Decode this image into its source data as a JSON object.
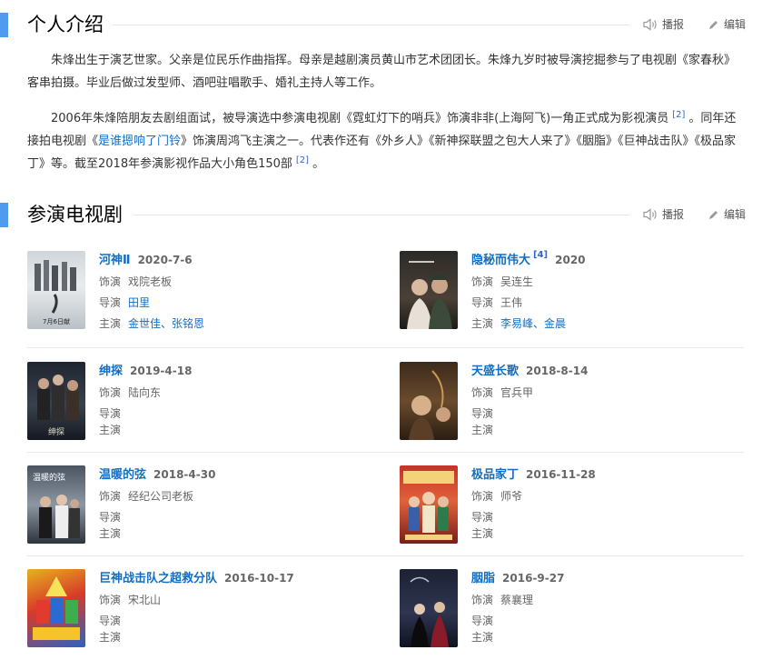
{
  "sections": {
    "intro": {
      "title": "个人介绍",
      "play_label": "播报",
      "edit_label": "编辑"
    },
    "tv": {
      "title": "参演电视剧",
      "play_label": "播报",
      "edit_label": "编辑"
    }
  },
  "intro": {
    "p1": "朱烽出生于演艺世家。父亲是位民乐作曲指挥。母亲是越剧演员黄山市艺术团团长。朱烽九岁时被导演挖掘参与了电视剧《家春秋》客串拍摄。毕业后做过发型师、酒吧驻唱歌手、婚礼主持人等工作。",
    "p2_a": "2006年朱烽陪朋友去剧组面试，被导演选中参演电视剧《霓虹灯下的哨兵》饰演非非(上海阿飞)一角正式成为影视演员",
    "p2_ref1": "[2]",
    "p2_b": "。同年还接拍电视剧《",
    "p2_link": "是谁摁响了门铃",
    "p2_c": "》饰演周鸿飞主演之一。代表作还有《外乡人》《新神探联盟之包大人来了》《胭脂》《巨神战击队》《极品家丁》等。截至2018年参演影视作品大小角色150部",
    "p2_ref2": "[2]",
    "p2_d": "。"
  },
  "labels": {
    "role": "饰演",
    "director": "导演",
    "cast": "主演"
  },
  "tv_items": [
    {
      "title": "河神Ⅱ",
      "sup": "",
      "date": "2020-7-6",
      "role": "戏院老板",
      "director": "田里",
      "cast": "金世佳、张铭恩"
    },
    {
      "title": "隐秘而伟大",
      "sup": "[4]",
      "date": "2020",
      "role": "吴连生",
      "director": "王伟",
      "cast": "李易峰、金晨"
    },
    {
      "title": "绅探",
      "sup": "",
      "date": "2019-4-18",
      "role": "陆向东",
      "director": "",
      "cast": ""
    },
    {
      "title": "天盛长歌",
      "sup": "",
      "date": "2018-8-14",
      "role": "官兵甲",
      "director": "",
      "cast": ""
    },
    {
      "title": "温暖的弦",
      "sup": "",
      "date": "2018-4-30",
      "role": "经纪公司老板",
      "director": "",
      "cast": ""
    },
    {
      "title": "极品家丁",
      "sup": "",
      "date": "2016-11-28",
      "role": "师爷",
      "director": "",
      "cast": ""
    },
    {
      "title": "巨神战击队之超救分队",
      "sup": "",
      "date": "2016-10-17",
      "role": "宋北山",
      "director": "",
      "cast": ""
    },
    {
      "title": "胭脂",
      "sup": "",
      "date": "2016-9-27",
      "role": "蔡襄理",
      "director": "",
      "cast": ""
    }
  ],
  "posters": [
    {
      "text": "7月6日献"
    },
    {
      "text": ""
    },
    {
      "text": "绅探"
    },
    {
      "text": ""
    },
    {
      "text": "温暖的弦"
    },
    {
      "text": ""
    },
    {
      "text": ""
    },
    {
      "text": ""
    }
  ],
  "colors": {
    "accent": "#4f9cee",
    "link": "#136ec2",
    "text": "#333333",
    "muted": "#666666"
  }
}
